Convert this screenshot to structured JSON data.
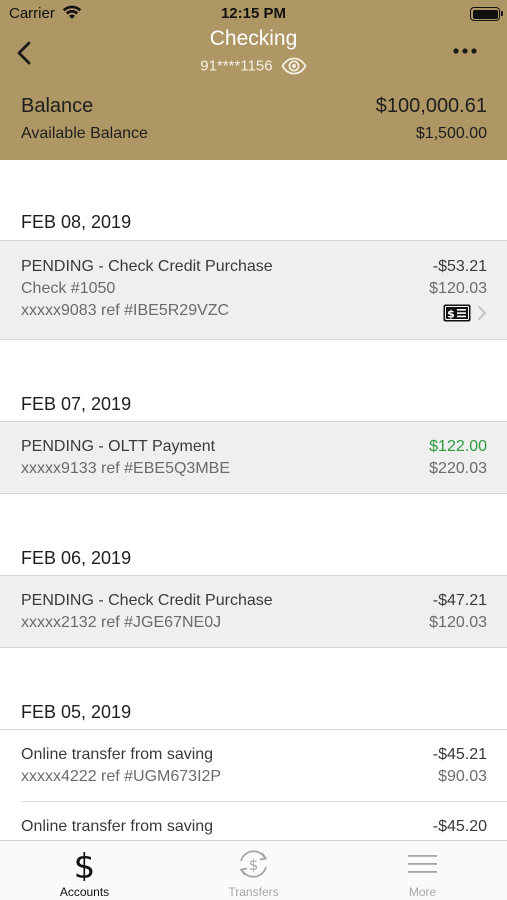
{
  "status_bar": {
    "carrier": "Carrier",
    "time": "12:15 PM"
  },
  "header": {
    "title": "Checking",
    "account_number": "91****1156",
    "background_color": "#ae9765"
  },
  "balance": {
    "label": "Balance",
    "value": "$100,000.61",
    "available_label": "Available Balance",
    "available_value": "$1,500.00"
  },
  "groups": [
    {
      "date": "FEB 08, 2019",
      "transactions": [
        {
          "description": "PENDING - Check Credit Purchase",
          "amount": "-$53.21",
          "detail": "Check #1050",
          "running_balance": "$120.03",
          "reference": "xxxxx9083 ref #IBE5R29VZC",
          "has_check_image": true
        }
      ]
    },
    {
      "date": "FEB 07, 2019",
      "transactions": [
        {
          "description": "PENDING - OLTT Payment",
          "amount": "$122.00",
          "amount_color": "#2e9b3e",
          "reference": "xxxxx9133 ref #EBE5Q3MBE",
          "running_balance": "$220.03"
        }
      ]
    },
    {
      "date": "FEB 06, 2019",
      "transactions": [
        {
          "description": "PENDING - Check Credit Purchase",
          "amount": "-$47.21",
          "reference": "xxxxx2132 ref #JGE67NE0J",
          "running_balance": "$120.03"
        }
      ]
    },
    {
      "date": "FEB 05, 2019",
      "transactions": [
        {
          "description": "Online transfer from saving",
          "amount": "-$45.21",
          "reference": "xxxxx4222 ref #UGM673I2P",
          "running_balance": "$90.03"
        },
        {
          "description": "Online transfer from saving",
          "amount": "-$45.20"
        }
      ]
    }
  ],
  "tabbar": {
    "tabs": [
      {
        "label": "Accounts",
        "icon": "dollar-icon",
        "active": true
      },
      {
        "label": "Transfers",
        "icon": "transfer-dollar-icon",
        "active": false
      },
      {
        "label": "More",
        "icon": "hamburger-menu-icon",
        "active": false
      }
    ]
  }
}
